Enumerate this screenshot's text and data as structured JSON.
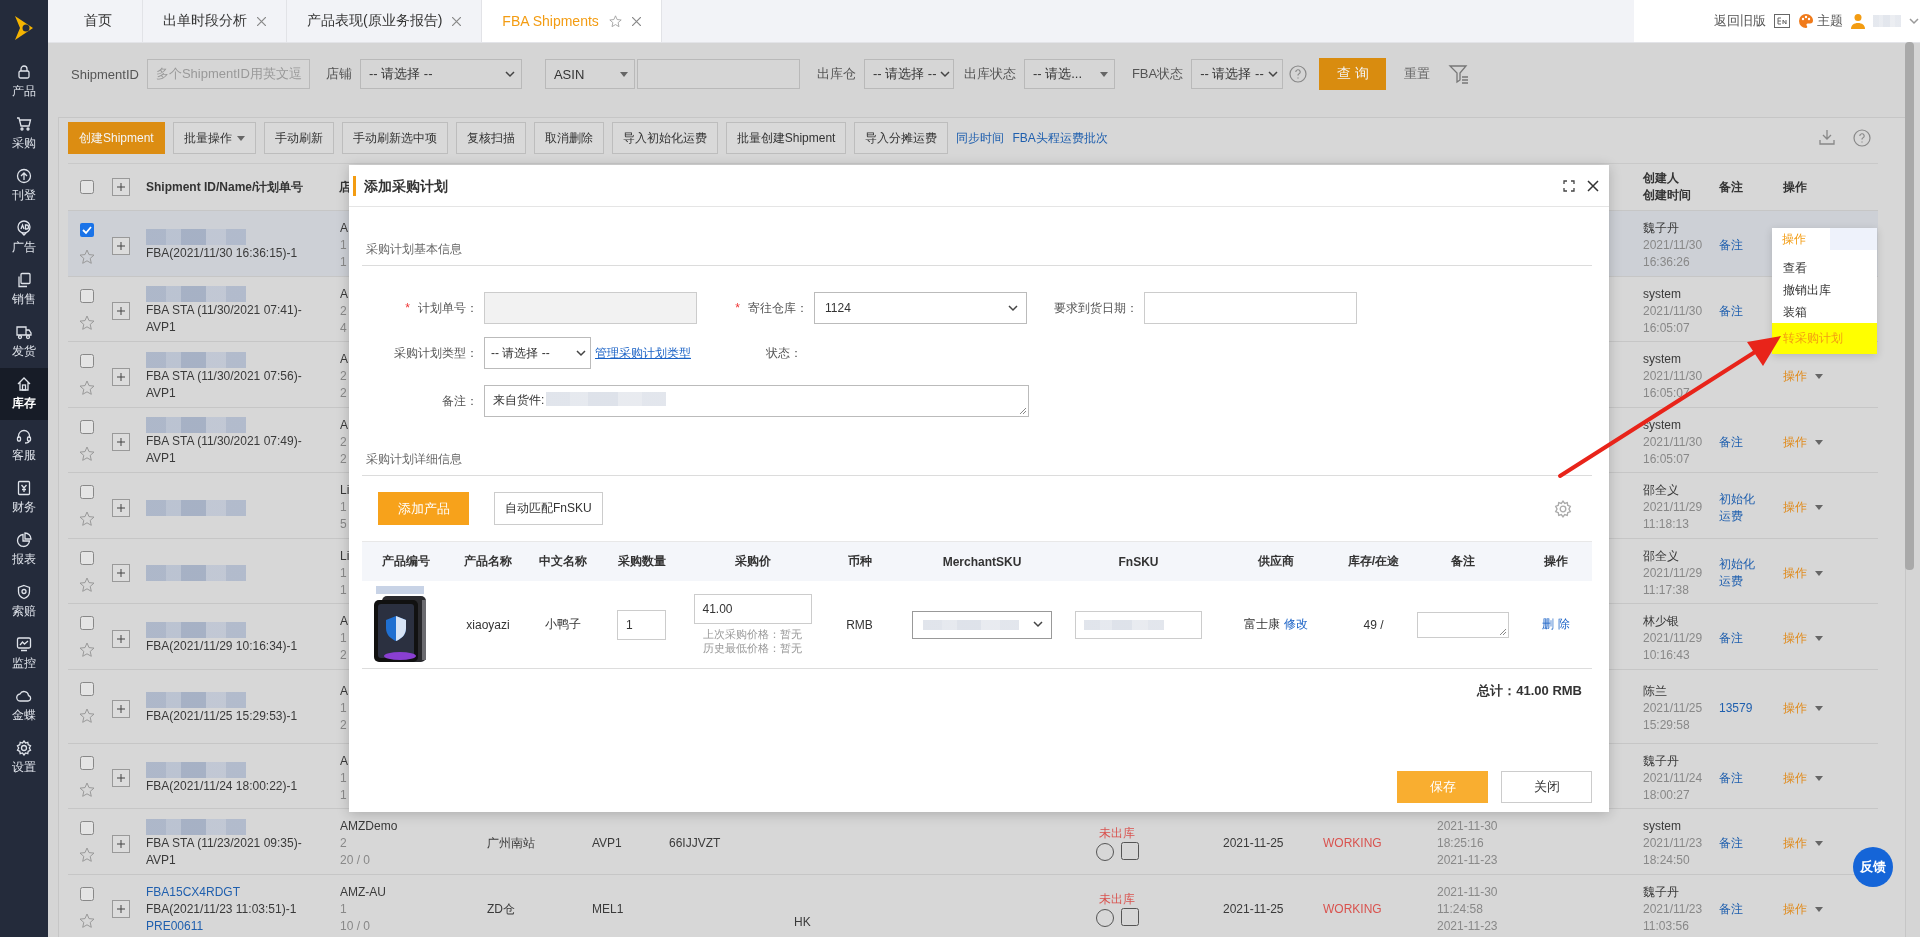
{
  "sidebar": {
    "items": [
      {
        "label": "产品",
        "selected": false
      },
      {
        "label": "采购",
        "selected": false
      },
      {
        "label": "刊登",
        "selected": false
      },
      {
        "label": "广告",
        "selected": false
      },
      {
        "label": "销售",
        "selected": false
      },
      {
        "label": "发货",
        "selected": false
      },
      {
        "label": "库存",
        "selected": true
      },
      {
        "label": "客服",
        "selected": false
      },
      {
        "label": "财务",
        "selected": false
      },
      {
        "label": "报表",
        "selected": false
      },
      {
        "label": "索赔",
        "selected": false
      },
      {
        "label": "监控",
        "selected": false
      },
      {
        "label": "金蝶",
        "selected": false
      },
      {
        "label": "设置",
        "selected": false
      }
    ]
  },
  "tabs": [
    {
      "label": "首页",
      "closable": false,
      "selected": false
    },
    {
      "label": "出单时段分析",
      "closable": true,
      "selected": false
    },
    {
      "label": "产品表现(原业务报告)",
      "closable": true,
      "selected": false
    },
    {
      "label": "FBA Shipments",
      "closable": true,
      "selected": true
    }
  ],
  "header_right": {
    "old_version": "返回旧版",
    "theme": "主题"
  },
  "filters": [
    {
      "kind": "input",
      "label": "ShipmentID",
      "placeholder": "多个ShipmentID用英文逗"
    },
    {
      "kind": "select",
      "label": "店铺",
      "value": "-- 请选择 --"
    },
    {
      "kind": "select-input",
      "value": "ASIN"
    },
    {
      "kind": "select",
      "label": "出库仓",
      "value": "-- 请选择 --"
    },
    {
      "kind": "select",
      "label": "出库状态",
      "value": "-- 请选..."
    },
    {
      "kind": "select",
      "label": "FBA状态",
      "value": "-- 请选择 --"
    }
  ],
  "search_button": "查 询",
  "reset": "重置",
  "toolbar": {
    "buttons": [
      {
        "label": "创建Shipment",
        "kind": "primary"
      },
      {
        "label": "批量操作",
        "kind": "dropdown"
      },
      {
        "label": "手动刷新",
        "kind": "default"
      },
      {
        "label": "手动刷新选中项",
        "kind": "default"
      },
      {
        "label": "复核扫描",
        "kind": "default"
      },
      {
        "label": "取消删除",
        "kind": "default"
      },
      {
        "label": "导入初始化运费",
        "kind": "default"
      },
      {
        "label": "批量创建Shipment",
        "kind": "default"
      },
      {
        "label": "导入分摊运费",
        "kind": "default"
      }
    ],
    "links": [
      "同步时间",
      "FBA头程运费批次"
    ]
  },
  "table": {
    "header": {
      "all_selected": false,
      "id": "Shipment ID/Name/计划单号",
      "store": "店",
      "creator": "创建人",
      "created_time": "创建时间",
      "remark": "备注",
      "action": "操作"
    },
    "rows": [
      {
        "selected": true,
        "id_redacted": true,
        "name": "FBA(2021/11/30 16:36:15)-1",
        "store": [
          "A",
          "1",
          "1"
        ],
        "creator": "魏子丹",
        "created_date": "2021/11/30",
        "created_time": "16:36:26",
        "remark": "备注"
      },
      {
        "selected": false,
        "id_redacted": true,
        "name": "FBA STA (11/30/2021 07:41)-AVP1",
        "store": [
          "A",
          "2",
          "4"
        ],
        "creator": "system",
        "created_date": "2021/11/30",
        "created_time": "16:05:07",
        "remark": "备注"
      },
      {
        "selected": false,
        "id_redacted": true,
        "name": "FBA STA (11/30/2021 07:56)-AVP1",
        "store": [
          "A",
          "2",
          "2"
        ],
        "creator": "system",
        "created_date": "2021/11/30",
        "created_time": "16:05:07",
        "action": "操作"
      },
      {
        "selected": false,
        "id_redacted": true,
        "name": "FBA STA (11/30/2021 07:49)-AVP1",
        "store": [
          "A",
          "2",
          "2"
        ],
        "creator": "system",
        "created_date": "2021/11/30",
        "created_time": "16:05:07",
        "remark": "备注",
        "action": "操作"
      },
      {
        "selected": false,
        "id_redacted": true,
        "store": [
          "Li",
          "1",
          "5"
        ],
        "creator": "邵全义",
        "created_date": "2021/11/29",
        "created_time": "11:18:13",
        "remark": "初始化运费",
        "action": "操作"
      },
      {
        "selected": false,
        "id_redacted": true,
        "store": [
          "Li",
          "1",
          "1"
        ],
        "creator": "邵全义",
        "created_date": "2021/11/29",
        "created_time": "11:17:38",
        "remark": "初始化运费",
        "action": "操作"
      },
      {
        "selected": false,
        "id_redacted": true,
        "name": "FBA(2021/11/29 10:16:34)-1",
        "store": [
          "A",
          "1",
          "2"
        ],
        "creator": "林少银",
        "created_date": "2021/11/29",
        "created_time": "10:16:43",
        "remark": "备注",
        "action": "操作"
      },
      {
        "selected": false,
        "id_redacted": true,
        "name": "FBA(2021/11/25 15:29:53)-1",
        "store": [
          "A",
          "1",
          "2"
        ],
        "creator": "陈兰",
        "created_date": "2021/11/25",
        "created_time": "15:29:58",
        "remark": "13579",
        "action": "操作"
      },
      {
        "selected": false,
        "id_redacted": true,
        "name": "FBA(2021/11/24 18:00:22)-1",
        "store": [
          "A",
          "1",
          "1"
        ],
        "creator": "魏子丹",
        "created_date": "2021/11/24",
        "created_time": "18:00:27",
        "remark": "备注",
        "action": "操作"
      },
      {
        "selected": false,
        "id_redacted": true,
        "name": "FBA STA (11/23/2021 09:35)-AVP1",
        "store": [
          "AMZDemo",
          "2",
          "20 / 0"
        ],
        "warehouse": "广州南站",
        "fc": "AVP1",
        "ref": "66IJJVZT",
        "status": "未出库",
        "date": "2021-11-25",
        "fba_status": "WORKING",
        "times": [
          "2021-11-30",
          "18:25:16",
          "2021-11-23"
        ],
        "creator": "system",
        "created_date": "2021/11/23",
        "created_time": "18:24:50",
        "remark": "备注",
        "action": "操作"
      },
      {
        "selected": false,
        "id_redacted": false,
        "id": "FBA15CX4RDGT",
        "name": "FBA(2021/11/23 11:03:51)-1",
        "plan_no": "PRE00611",
        "store": [
          "AMZ-AU",
          "1",
          "10 / 0"
        ],
        "warehouse": "ZD仓",
        "fc": "MEL1",
        "country": "HK",
        "status": "未出库",
        "date": "2021-11-25",
        "fba_status": "WORKING",
        "times": [
          "2021-11-30",
          "11:24:58",
          "2021-11-23"
        ],
        "creator": "魏子丹",
        "created_date": "2021/11/23",
        "created_time": "11:03:56",
        "remark": "备注",
        "action": "操作"
      }
    ]
  },
  "menu": {
    "trigger": "操作",
    "items": [
      {
        "label": "查看",
        "highlighted": false
      },
      {
        "label": "撤销出库",
        "highlighted": false
      },
      {
        "label": "装箱",
        "highlighted": false
      },
      {
        "label": "转采购计划",
        "highlighted": true
      }
    ]
  },
  "modal": {
    "title": "添加采购计划",
    "basic": {
      "title": "采购计划基本信息",
      "plan_no": {
        "required_mark": "*",
        "label": "计划单号：",
        "disabled": true
      },
      "warehouse": {
        "required_mark": "*",
        "label": "寄往仓库：",
        "value": "1124"
      },
      "arrival_date": {
        "label": "要求到货日期："
      },
      "plan_type": {
        "label": "采购计划类型：",
        "value": "-- 请选择 --",
        "link": "管理采购计划类型"
      },
      "status": {
        "label": "状态："
      },
      "remark": {
        "label": "备注：",
        "value": "来自货件:",
        "redacted": true
      }
    },
    "detail": {
      "title": "采购计划详细信息",
      "add_button": "添加产品",
      "match_button": "自动匹配FnSKU",
      "columns": [
        "产品编号",
        "产品名称",
        "中文名称",
        "采购数量",
        "采购价",
        "币种",
        "MerchantSKU",
        "FnSKU",
        "供应商",
        "库存/在途",
        "备注",
        "操作"
      ],
      "rows": [
        {
          "kind": "picture",
          "name": "xiaoyazi",
          "cn_name": "小鸭子",
          "qty": "1",
          "price": "41.00",
          "last_price": "上次采购价格：暂无",
          "lowest_price": "历史最低价格：暂无",
          "currency": "RMB",
          "merchant_sku_redacted": true,
          "fnsku_redacted": true,
          "supplier": "富士康",
          "edit_link": "修改",
          "stock": "49 /",
          "delete": "删 除"
        }
      ],
      "total": "总计：41.00  RMB"
    },
    "save": "保存",
    "close": "关闭"
  },
  "feedback": "反馈"
}
